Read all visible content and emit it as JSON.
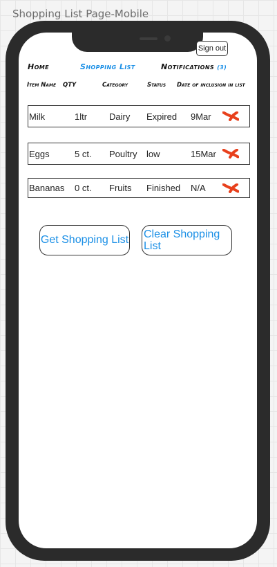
{
  "canvas_title": "Shopping List Page-Mobile",
  "header": {
    "signout_label": "Sign out"
  },
  "nav": {
    "home": "Home",
    "shopping_list": "Shopping List",
    "notifications": "Notifications",
    "notifications_count": "(3)"
  },
  "columns": {
    "item_name": "Item Name",
    "qty": "QTY",
    "category": "Category",
    "status": "Status",
    "date": "Date of inclusion in list"
  },
  "rows": [
    {
      "name": "Milk",
      "qty": "1ltr",
      "category": "Dairy",
      "status": "Expired",
      "date": "9Mar"
    },
    {
      "name": "Eggs",
      "qty": "5 ct.",
      "category": "Poultry",
      "status": "low",
      "date": "15Mar"
    },
    {
      "name": "Bananas",
      "qty": "0 ct.",
      "category": "Fruits",
      "status": "Finished",
      "date": "N/A"
    }
  ],
  "buttons": {
    "get": "Get Shopping List",
    "clear": "Clear Shopping List"
  },
  "colors": {
    "accent": "#1a8fe6",
    "delete_icon": "#e8401c",
    "device": "#2b2b2b"
  },
  "icons": {
    "delete": "close-x-icon"
  }
}
